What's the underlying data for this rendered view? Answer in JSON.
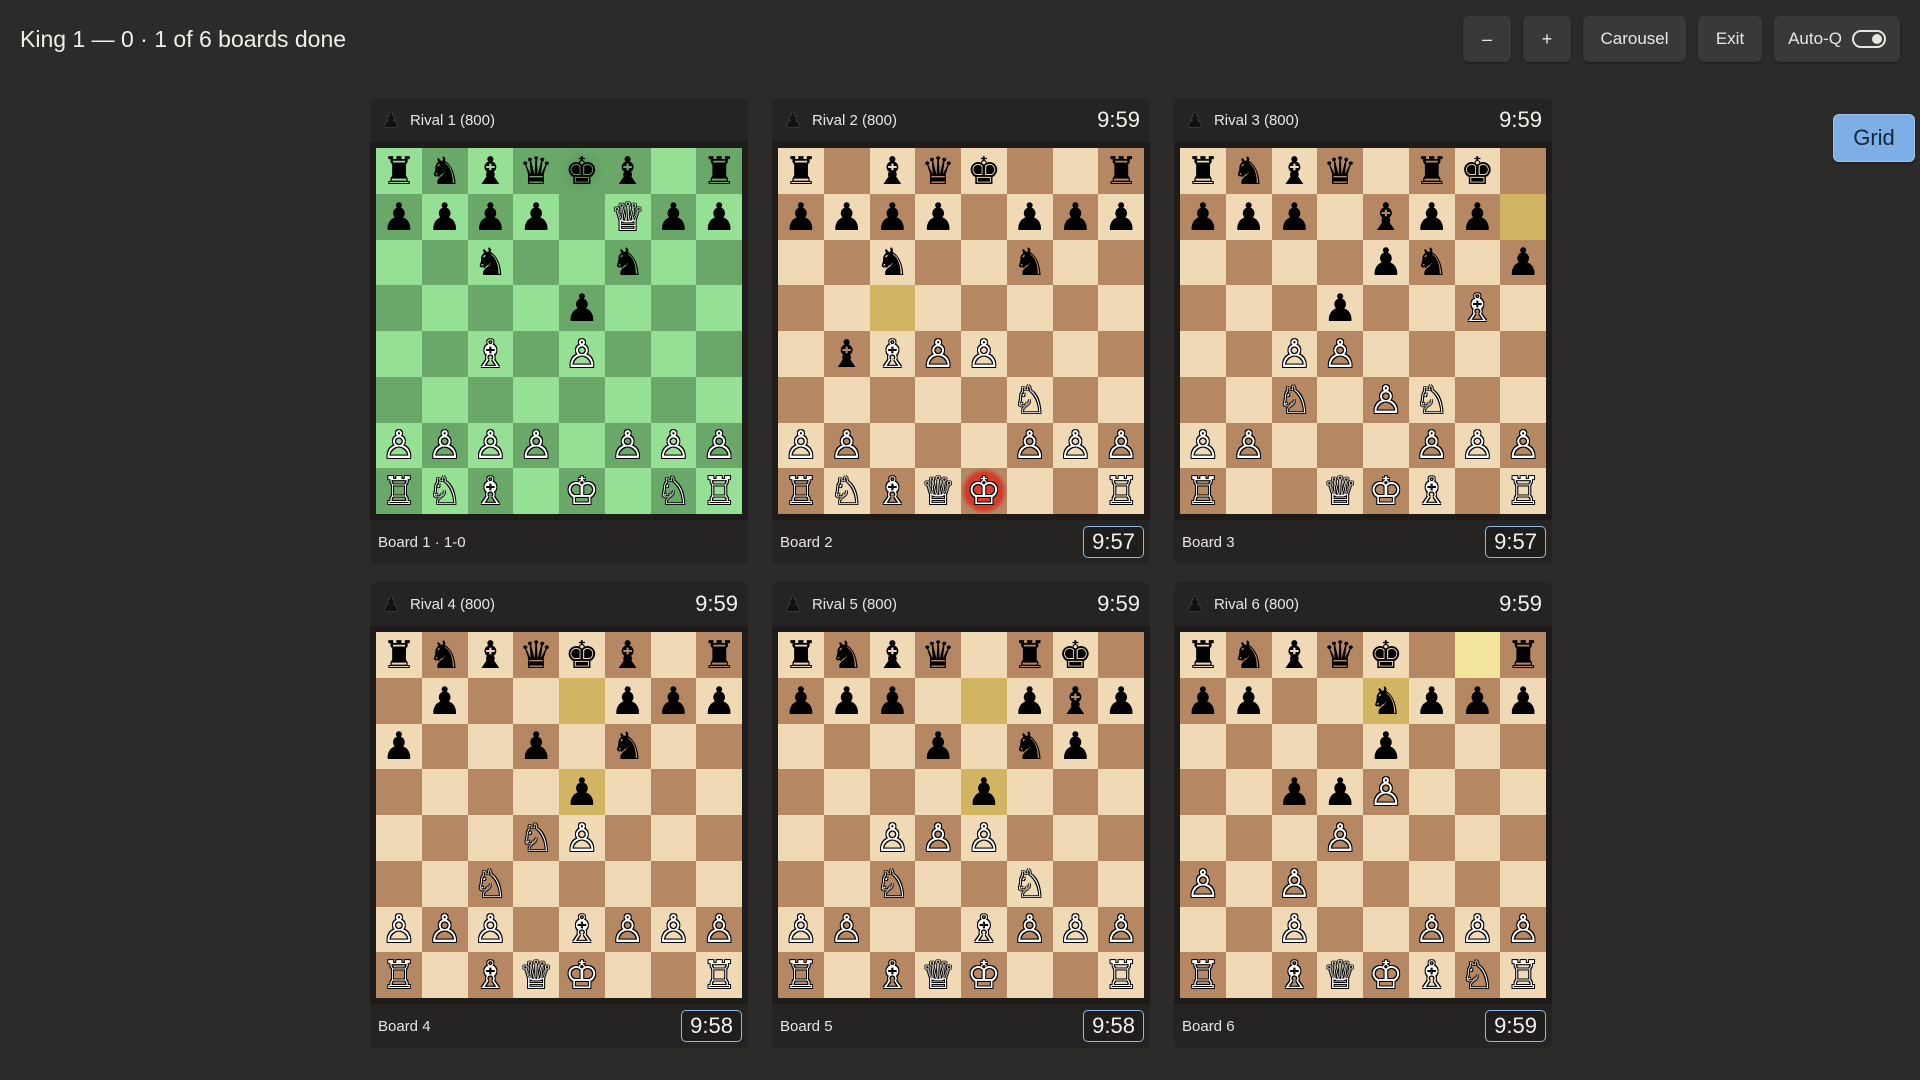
{
  "header": {
    "status": "King 1 — 0  ·  1 of 6 boards done"
  },
  "toolbar": {
    "zoom_out_label": "–",
    "zoom_in_label": "+",
    "grid_label": "Grid",
    "carousel_label": "Carousel",
    "exit_label": "Exit",
    "autoq_label": "Auto-Q",
    "autoq_on": true
  },
  "boards": [
    {
      "opponent": "Rival 1 (800)",
      "opponent_clock": "",
      "label": "Board 1  ·  1-0",
      "my_clock": "",
      "finished": true,
      "fen": [
        "rnbqkb.r",
        "pppp.Qpp",
        "..n..n..",
        "....p...",
        "..B.P...",
        "........",
        "PPPP.PPP",
        "RNB.K.NR"
      ],
      "highlights": [],
      "check": "e8",
      "dim": true
    },
    {
      "opponent": "Rival 2 (800)",
      "opponent_clock": "9:59",
      "label": "Board 2",
      "my_clock": "9:57",
      "finished": false,
      "fen": [
        "r.bqk..r",
        "pppp.ppp",
        "..n..n..",
        "........",
        ".bBPP...",
        ".....N..",
        "PP...PPP",
        "RNBQK..R"
      ],
      "highlights": [
        "c5"
      ],
      "check": "e1"
    },
    {
      "opponent": "Rival 3 (800)",
      "opponent_clock": "9:59",
      "label": "Board 3",
      "my_clock": "9:57",
      "finished": false,
      "fen": [
        "rnbq.rk.",
        "ppp.bpp.",
        "....pn.p",
        "...p..B.",
        "..PP....",
        "..N.PN..",
        "PP...PPP",
        "R..QKB.R"
      ],
      "highlights": [
        "h7"
      ]
    },
    {
      "opponent": "Rival 4 (800)",
      "opponent_clock": "9:59",
      "label": "Board 4",
      "my_clock": "9:58",
      "finished": false,
      "fen": [
        "rnbqkb.r",
        ".p...ppp",
        "p..p.n..",
        "....p...",
        "...NP...",
        "..N.....",
        "PPP.BPPP",
        "R.BQK..R"
      ],
      "highlights": [
        "e7",
        "e5"
      ]
    },
    {
      "opponent": "Rival 5 (800)",
      "opponent_clock": "9:59",
      "label": "Board 5",
      "my_clock": "9:58",
      "finished": false,
      "fen": [
        "rnbq.rk.",
        "ppp..pbp",
        "...p.np.",
        "....p...",
        "..PPP...",
        "..N..N..",
        "PP..BPPP",
        "R.BQK..R"
      ],
      "highlights": [
        "e7",
        "e5"
      ]
    },
    {
      "opponent": "Rival 6 (800)",
      "opponent_clock": "9:59",
      "label": "Board 6",
      "my_clock": "9:59",
      "finished": false,
      "fen": [
        "rnbqk..r",
        "pp..nppp",
        "....p...",
        "..ppP...",
        "...P....",
        "P.P.....",
        "..P..PPP",
        "R.BQKBNR"
      ],
      "highlights": [
        "e7"
      ],
      "highlights_yellow": [
        "g8"
      ]
    }
  ],
  "icons": {
    "opponent": "black-pawn-icon"
  }
}
